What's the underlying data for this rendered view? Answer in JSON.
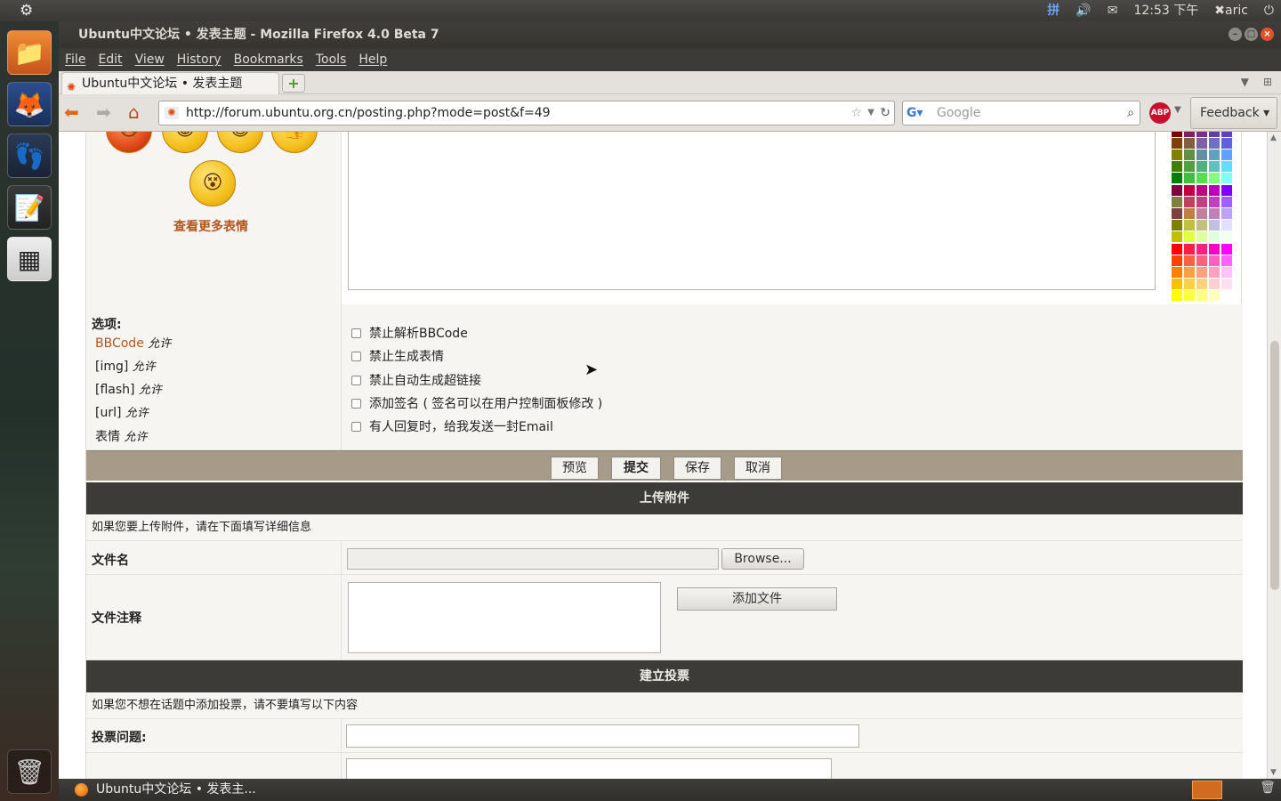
{
  "topbar": {
    "input_method": "拼",
    "volume_icon": "speaker-icon",
    "mail_icon": "envelope-icon",
    "clock": "12:53 下午",
    "user": "aric"
  },
  "launcher": {
    "apps": [
      "files-icon",
      "firefox-icon",
      "empathy-icon",
      "notes-icon",
      "workspaces-icon"
    ],
    "trash": "trash-icon"
  },
  "window": {
    "title": "Ubuntu中文论坛 • 发表主题 - Mozilla Firefox 4.0 Beta 7"
  },
  "menu": [
    "File",
    "Edit",
    "View",
    "History",
    "Bookmarks",
    "Tools",
    "Help"
  ],
  "tab": {
    "title": "Ubuntu中文论坛 • 发表主题",
    "new_tab": "+"
  },
  "navbar": {
    "url": "http://forum.ubuntu.org.cn/posting.php?mode=post&f=49",
    "search_placeholder": "Google",
    "abp": "ABP",
    "feedback": "Feedback"
  },
  "smilies": {
    "more_link": "查看更多表情"
  },
  "options": {
    "heading": "选项:",
    "items": [
      {
        "key": "BBCode",
        "value": "允许"
      },
      {
        "key": "[img]",
        "value": "允许"
      },
      {
        "key": "[flash]",
        "value": "允许"
      },
      {
        "key": "[url]",
        "value": "允许"
      },
      {
        "key": "表情",
        "value": "允许"
      }
    ],
    "checkboxes": [
      "禁止解析BBCode",
      "禁止生成表情",
      "禁止自动生成超链接",
      "添加签名 ( 签名可以在用户控制面板修改 )",
      "有人回复时，给我发送一封Email"
    ]
  },
  "buttons": {
    "preview": "预览",
    "submit": "提交",
    "save": "保存",
    "cancel": "取消"
  },
  "upload": {
    "heading": "上传附件",
    "info": "如果您要上传附件，请在下面填写详细信息",
    "filename_label": "文件名",
    "browse": "Browse...",
    "comment_label": "文件注释",
    "add_file": "添加文件"
  },
  "poll": {
    "heading": "建立投票",
    "info": "如果您不想在话题中添加投票，请不要填写以下内容",
    "question_label": "投票问题:"
  },
  "taskbar": {
    "item": "Ubuntu中文论坛 • 发表主..."
  }
}
